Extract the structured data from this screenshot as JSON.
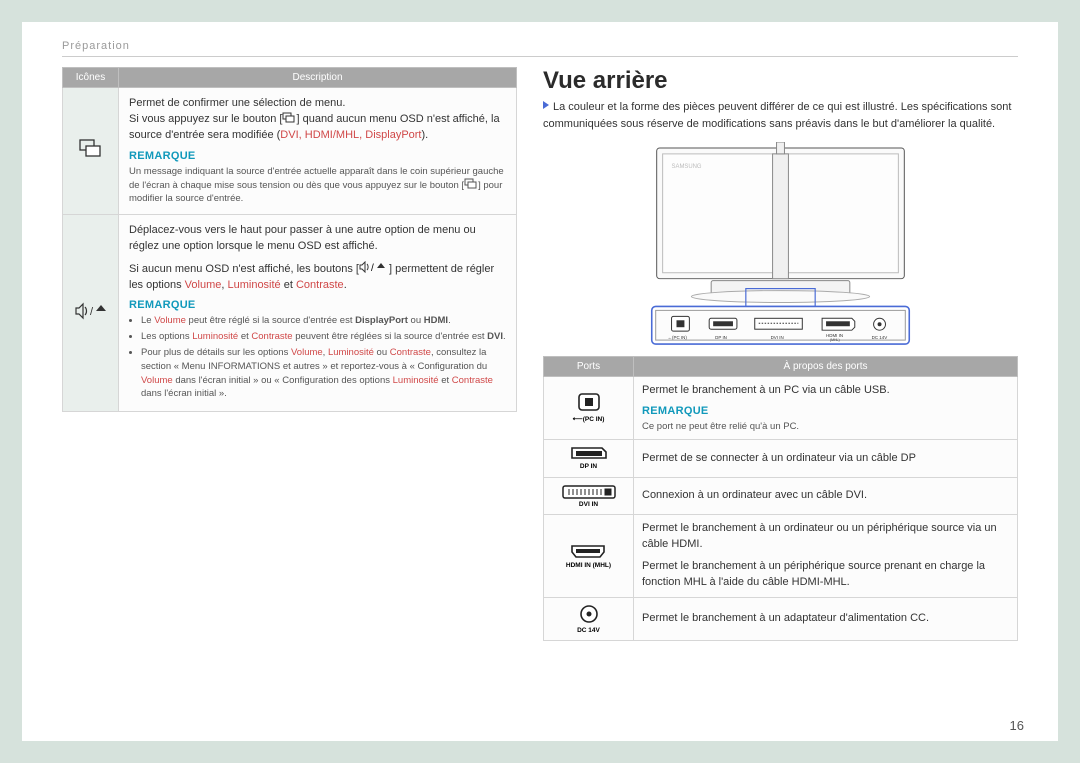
{
  "header": {
    "breadcrumb": "Préparation"
  },
  "leftTable": {
    "headers": [
      "Icônes",
      "Description"
    ],
    "row1": {
      "line1": "Permet de confirmer une sélection de menu.",
      "line2_a": "Si vous appuyez sur le bouton [",
      "line2_b": "] quand aucun menu OSD n'est affiché, la source d'entrée sera modifiée (",
      "line2_src": "DVI, HDMI/MHL, DisplayPort",
      "line2_c": ").",
      "remark": "REMARQUE",
      "note_a": "Un message indiquant la source d'entrée actuelle apparaît dans le coin supérieur gauche de l'écran à chaque mise sous tension ou dès que vous appuyez sur le bouton [",
      "note_b": "] pour modifier la source d'entrée."
    },
    "row2": {
      "p1": "Déplacez-vous vers le haut pour passer à une autre option de menu ou réglez une option lorsque le menu OSD est affiché.",
      "p2_a": "Si aucun menu OSD n'est affiché, les boutons [",
      "p2_b": "] permettent de régler les options ",
      "p2_vol": "Volume",
      "p2_sep1": ", ",
      "p2_lum": "Luminosité",
      "p2_sep2": " et ",
      "p2_con": "Contraste",
      "p2_end": ".",
      "remark": "REMARQUE",
      "b1_a": "Le ",
      "b1_vol": "Volume",
      "b1_b": " peut être réglé si la source d'entrée est ",
      "b1_dp": "DisplayPort",
      "b1_or": " ou ",
      "b1_hdmi": "HDMI",
      "b1_end": ".",
      "b2_a": "Les options ",
      "b2_lum": "Luminosité",
      "b2_and": " et ",
      "b2_con": "Contraste",
      "b2_b": " peuvent être réglées si la source d'entrée est ",
      "b2_dvi": "DVI",
      "b2_end": ".",
      "b3_a": "Pour plus de détails sur les options ",
      "b3_vol": "Volume",
      "b3_s1": ", ",
      "b3_lum": "Luminosité",
      "b3_s2": " ou ",
      "b3_con": "Contraste",
      "b3_b": ", consultez la section « Menu INFORMATIONS et autres » et reportez-vous à « Configuration du ",
      "b3_vol2": "Volume",
      "b3_c": " dans l'écran initial » ou « Configuration des options ",
      "b3_lum2": "Luminosité",
      "b3_and2": " et ",
      "b3_con2": "Contraste",
      "b3_d": " dans l'écran initial »."
    }
  },
  "right": {
    "title": "Vue arrière",
    "intro": "La couleur et la forme des pièces peuvent différer de ce qui est illustré. Les spécifications sont communiquées sous réserve de modifications sans préavis dans le but d'améliorer la qualité.",
    "portsHeaders": [
      "Ports",
      "À propos des ports"
    ],
    "ports": [
      {
        "label": "(PC IN)",
        "pre": "",
        "desc": "Permet le branchement à un PC via un câble USB.",
        "remark": "REMARQUE",
        "note": "Ce port ne peut être relié qu'à un PC.",
        "icon": "usb"
      },
      {
        "label": "DP IN",
        "desc": "Permet de se connecter à un ordinateur via un câble DP",
        "icon": "dp"
      },
      {
        "label": "DVI IN",
        "desc": "Connexion à un ordinateur avec un câble DVI.",
        "icon": "dvi"
      },
      {
        "label": "HDMI IN (MHL)",
        "desc1": "Permet le branchement à un ordinateur ou un périphérique source via un câble HDMI.",
        "desc2": "Permet le branchement à un périphérique source prenant en charge la fonction MHL à l'aide du câble HDMI-MHL.",
        "icon": "hdmi"
      },
      {
        "label": "DC 14V",
        "desc": "Permet le branchement à un adaptateur d'alimentation CC.",
        "icon": "dc"
      }
    ]
  },
  "pageNumber": "16"
}
